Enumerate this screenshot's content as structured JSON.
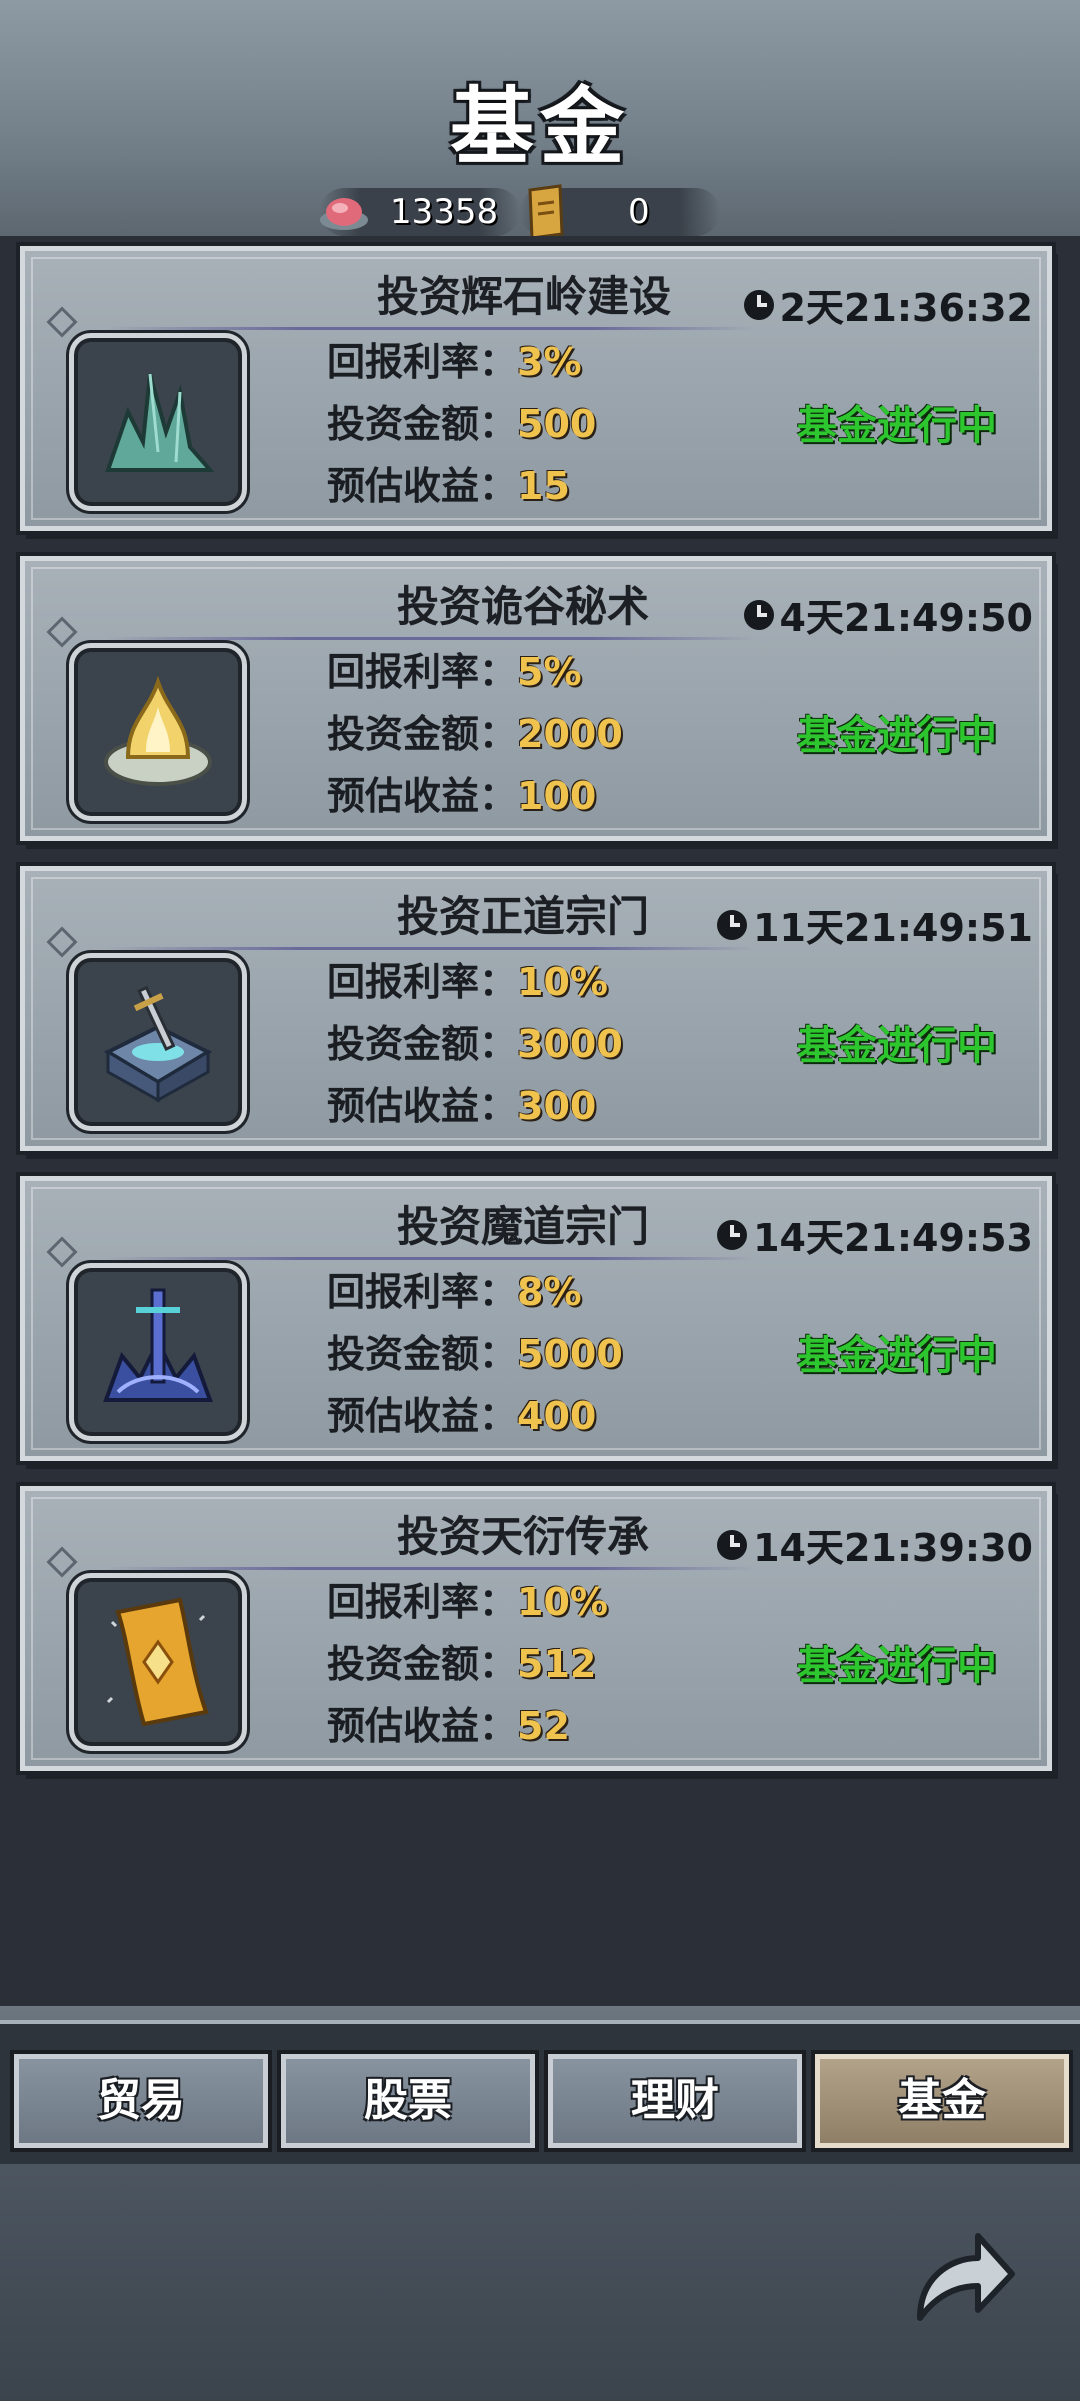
{
  "header": {
    "title": "基金",
    "currencies": [
      {
        "icon": "meat-icon",
        "value": "13358"
      },
      {
        "icon": "scroll-ticket-icon",
        "value": "0"
      }
    ]
  },
  "labels": {
    "rate": "回报利率：",
    "amount": "投资金额：",
    "profit": "预估收益："
  },
  "funds": [
    {
      "title": "投资辉石岭建设",
      "timer": "2天21:36:32",
      "rate": "3%",
      "amount": "500",
      "profit": "15",
      "status": "基金进行中",
      "icon": "crystal-icon"
    },
    {
      "title": "投资诡谷秘术",
      "timer": "4天21:49:50",
      "rate": "5%",
      "amount": "2000",
      "profit": "100",
      "status": "基金进行中",
      "icon": "flame-lotus-icon"
    },
    {
      "title": "投资正道宗门",
      "timer": "11天21:49:51",
      "rate": "10%",
      "amount": "3000",
      "profit": "300",
      "status": "基金进行中",
      "icon": "sword-altar-icon"
    },
    {
      "title": "投资魔道宗门",
      "timer": "14天21:49:53",
      "rate": "8%",
      "amount": "5000",
      "profit": "400",
      "status": "基金进行中",
      "icon": "demon-sword-icon"
    },
    {
      "title": "投资天衍传承",
      "timer": "14天21:39:30",
      "rate": "10%",
      "amount": "512",
      "profit": "52",
      "status": "基金进行中",
      "icon": "talisman-icon"
    }
  ],
  "tabs": [
    {
      "label": "贸易",
      "active": false
    },
    {
      "label": "股票",
      "active": false
    },
    {
      "label": "理财",
      "active": false
    },
    {
      "label": "基金",
      "active": true
    }
  ],
  "colors": {
    "status": "#2ec62e",
    "value": "#f0c24e",
    "active_tab": "#b2a289"
  }
}
